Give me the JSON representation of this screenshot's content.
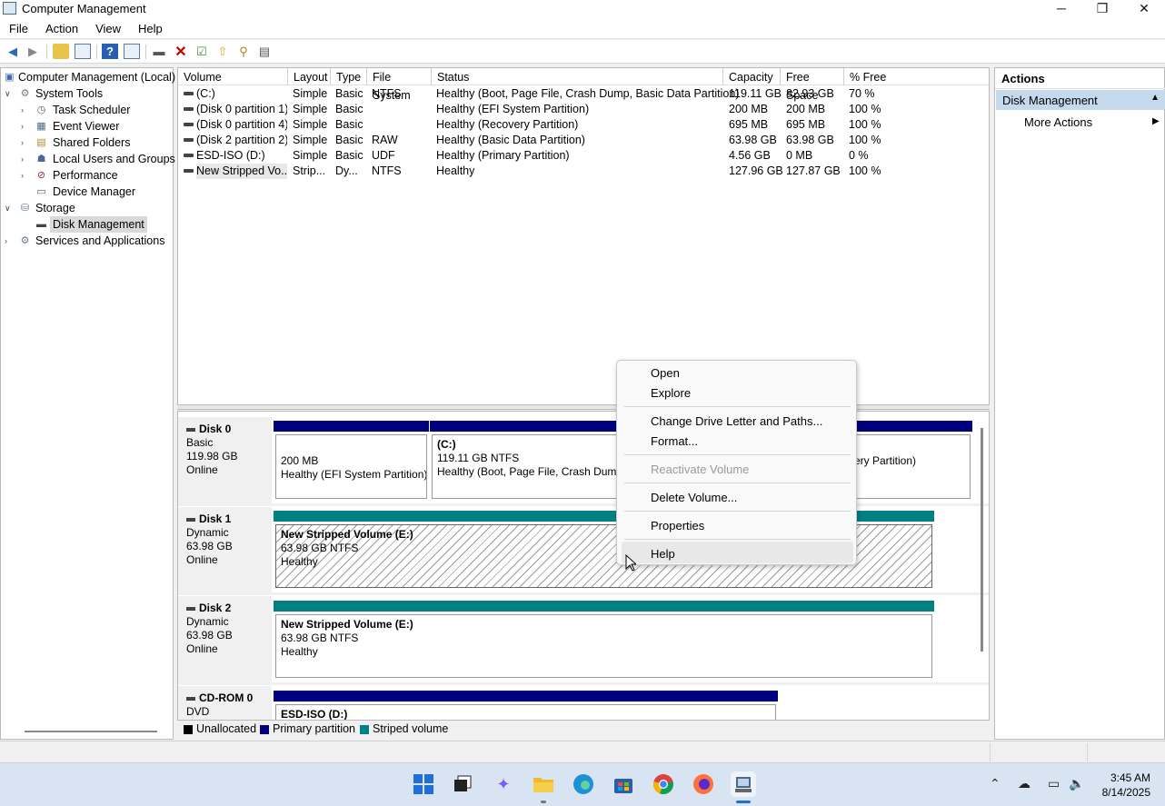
{
  "window": {
    "title": "Computer Management",
    "minimize_icon": "─",
    "maximize_icon": "❐",
    "close_icon": "✕"
  },
  "menu": [
    "File",
    "Action",
    "View",
    "Help"
  ],
  "tree": {
    "root": "Computer Management (Local)",
    "system_tools": "System Tools",
    "task_scheduler": "Task Scheduler",
    "event_viewer": "Event Viewer",
    "shared_folders": "Shared Folders",
    "local_users": "Local Users and Groups",
    "performance": "Performance",
    "device_manager": "Device Manager",
    "storage": "Storage",
    "disk_management": "Disk Management",
    "services": "Services and Applications"
  },
  "volumes": {
    "columns": [
      "Volume",
      "Layout",
      "Type",
      "File System",
      "Status",
      "Capacity",
      "Free Space",
      "% Free"
    ],
    "rows": [
      [
        "(C:)",
        "Simple",
        "Basic",
        "NTFS",
        "Healthy (Boot, Page File, Crash Dump, Basic Data Partition)",
        "119.11 GB",
        "82.93 GB",
        "70 %"
      ],
      [
        "(Disk 0 partition 1)",
        "Simple",
        "Basic",
        "",
        "Healthy (EFI System Partition)",
        "200 MB",
        "200 MB",
        "100 %"
      ],
      [
        "(Disk 0 partition 4)",
        "Simple",
        "Basic",
        "",
        "Healthy (Recovery Partition)",
        "695 MB",
        "695 MB",
        "100 %"
      ],
      [
        "(Disk 2 partition 2)",
        "Simple",
        "Basic",
        "RAW",
        "Healthy (Basic Data Partition)",
        "63.98 GB",
        "63.98 GB",
        "100 %"
      ],
      [
        "ESD-ISO (D:)",
        "Simple",
        "Basic",
        "UDF",
        "Healthy (Primary Partition)",
        "4.56 GB",
        "0 MB",
        "0 %"
      ],
      [
        "New Stripped Vo...",
        "Strip...",
        "Dy...",
        "NTFS",
        "Healthy",
        "127.96 GB",
        "127.87 GB",
        "100 %"
      ]
    ]
  },
  "disks": {
    "disk0": {
      "name": "Disk 0",
      "type": "Basic",
      "size": "119.98 GB",
      "state": "Online",
      "p1_size": "200 MB",
      "p1_status": "Healthy (EFI System Partition)",
      "p2_name": "(C:)",
      "p2_size": "119.11 GB NTFS",
      "p2_status": "Healthy (Boot, Page File, Crash Dump",
      "p3_status": "ery Partition)"
    },
    "disk1": {
      "name": "Disk 1",
      "type": "Dynamic",
      "size": "63.98 GB",
      "state": "Online",
      "vol_name": "New Stripped Volume  (E:)",
      "vol_size": "63.98 GB NTFS",
      "vol_status": "Healthy"
    },
    "disk2": {
      "name": "Disk 2",
      "type": "Dynamic",
      "size": "63.98 GB",
      "state": "Online",
      "vol_name": "New Stripped Volume  (E:)",
      "vol_size": "63.98 GB NTFS",
      "vol_status": "Healthy"
    },
    "cdrom0": {
      "name": "CD-ROM 0",
      "type": "DVD",
      "vol_name": "ESD-ISO  (D:)"
    }
  },
  "legend": {
    "unallocated": "Unallocated",
    "primary": "Primary partition",
    "striped": "Striped volume"
  },
  "colors": {
    "primary": "#00007f",
    "striped": "#008080",
    "unallocated": "#000000",
    "selection": "#c5d9ec"
  },
  "actions": {
    "header": "Actions",
    "section": "Disk Management",
    "more": "More Actions"
  },
  "context_menu": {
    "open": "Open",
    "explore": "Explore",
    "change_letter": "Change Drive Letter and Paths...",
    "format": "Format...",
    "reactivate": "Reactivate Volume",
    "delete": "Delete Volume...",
    "properties": "Properties",
    "help": "Help"
  },
  "taskbar": {
    "time": "3:45 AM",
    "date": "8/14/2025"
  }
}
